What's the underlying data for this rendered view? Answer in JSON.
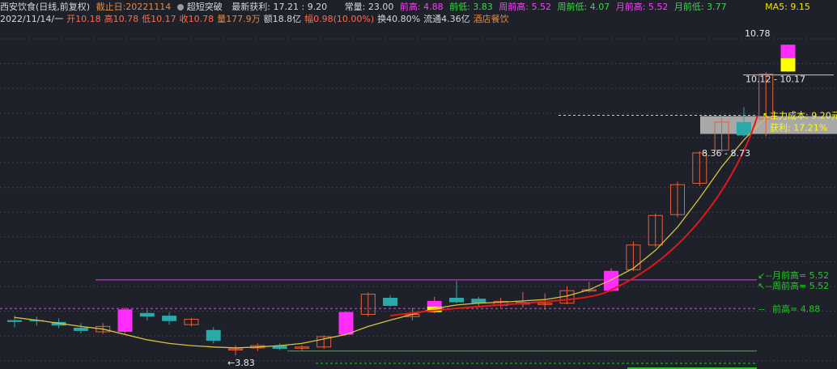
{
  "header": {
    "row1": {
      "stock_name": "西安饮食(日线,前复权)",
      "cutoff": "截止日:20221114",
      "signal": "超短突破",
      "profit": "最新获利: 17.21 : 9.20",
      "normal": "常量: 23.00",
      "prev_high": "前高: 4.88",
      "prev_low": "前低: 3.83",
      "week_high": "周前高: 5.52",
      "week_low": "周前低: 4.07",
      "month_high": "月前高: 5.52",
      "month_low": "月前低: 3.77",
      "ma5": "MA5: 9.15"
    },
    "row2": {
      "date": "2022/11/14/一",
      "open": "开10.18",
      "high": "高10.78",
      "low": "低10.17",
      "close": "收10.78",
      "volume": "量177.9万",
      "amount": "额18.8亿",
      "change": "幅0.98(10.00%)",
      "turnover": "换40.80%",
      "float": "流通4.36亿",
      "industry": "酒店餐饮"
    }
  },
  "annotations": {
    "high_price": "10.78",
    "range_top": "10.12 - 10.17",
    "cost_label": "主力成本:  9.20元",
    "profit_label": "获利:  17.21%",
    "range_mid": "8.36 - 8.73",
    "month_prev_high": "--月前高= 5.52",
    "week_prev_high": "--周前高= 5.52",
    "prev_high_line": "前高= 4.88",
    "low_marker": "←3.83"
  },
  "colors": {
    "background": "#1e2129",
    "up": "#e8603a",
    "down": "#2aa9a9",
    "magenta": "#ff2cff",
    "yellow": "#ffff00",
    "ma5": "#d8c040",
    "cost_line": "#e01818",
    "green_line": "#27c627"
  },
  "chart_data": {
    "type": "candlestick",
    "title": "西安饮食(日线,前复权)",
    "ylim": [
      3.6,
      11.2
    ],
    "grid": true,
    "candles": [
      {
        "o": 4.62,
        "h": 4.72,
        "l": 4.46,
        "c": 4.58
      },
      {
        "o": 4.62,
        "h": 4.7,
        "l": 4.5,
        "c": 4.6
      },
      {
        "o": 4.58,
        "h": 4.66,
        "l": 4.44,
        "c": 4.5
      },
      {
        "o": 4.45,
        "h": 4.55,
        "l": 4.33,
        "c": 4.38
      },
      {
        "o": 4.36,
        "h": 4.55,
        "l": 4.31,
        "c": 4.48
      },
      {
        "o": 4.36,
        "h": 4.9,
        "l": 4.33,
        "c": 4.86,
        "mark": "break"
      },
      {
        "o": 4.78,
        "h": 4.85,
        "l": 4.62,
        "c": 4.7
      },
      {
        "o": 4.72,
        "h": 4.8,
        "l": 4.52,
        "c": 4.6
      },
      {
        "o": 4.52,
        "h": 4.67,
        "l": 4.48,
        "c": 4.64
      },
      {
        "o": 4.4,
        "h": 4.46,
        "l": 4.1,
        "c": 4.16
      },
      {
        "o": 3.98,
        "h": 4.06,
        "l": 3.83,
        "c": 3.98
      },
      {
        "o": 4.0,
        "h": 4.1,
        "l": 3.93,
        "c": 4.05
      },
      {
        "o": 4.05,
        "h": 4.1,
        "l": 3.95,
        "c": 3.98
      },
      {
        "o": 4.0,
        "h": 4.06,
        "l": 3.94,
        "c": 4.02
      },
      {
        "o": 4.02,
        "h": 4.28,
        "l": 3.98,
        "c": 4.25
      },
      {
        "o": 4.3,
        "h": 4.82,
        "l": 4.28,
        "c": 4.8,
        "mark": "prev"
      },
      {
        "o": 4.75,
        "h": 5.24,
        "l": 4.7,
        "c": 5.2
      },
      {
        "o": 5.12,
        "h": 5.18,
        "l": 4.92,
        "c": 4.94
      },
      {
        "o": 4.7,
        "h": 4.9,
        "l": 4.62,
        "c": 4.75
      },
      {
        "o": 4.8,
        "h": 5.14,
        "l": 4.78,
        "c": 5.05,
        "mark": "mid"
      },
      {
        "o": 5.12,
        "h": 5.5,
        "l": 5.0,
        "c": 5.02
      },
      {
        "o": 5.1,
        "h": 5.14,
        "l": 4.92,
        "c": 5.0
      },
      {
        "o": 4.95,
        "h": 5.12,
        "l": 4.9,
        "c": 5.04
      },
      {
        "o": 4.98,
        "h": 5.25,
        "l": 4.9,
        "c": 5.02
      },
      {
        "o": 4.97,
        "h": 5.22,
        "l": 4.85,
        "c": 5.0
      },
      {
        "o": 5.0,
        "h": 5.38,
        "l": 4.98,
        "c": 5.28
      },
      {
        "o": 5.28,
        "h": 5.48,
        "l": 5.24,
        "c": 5.3
      },
      {
        "o": 5.28,
        "h": 5.78,
        "l": 5.25,
        "c": 5.72,
        "mark": "break"
      },
      {
        "o": 5.75,
        "h": 6.38,
        "l": 5.72,
        "c": 6.3
      },
      {
        "o": 6.3,
        "h": 7.0,
        "l": 6.25,
        "c": 6.96
      },
      {
        "o": 6.98,
        "h": 7.72,
        "l": 6.92,
        "c": 7.65
      },
      {
        "o": 7.68,
        "h": 8.4,
        "l": 7.62,
        "c": 8.36
      },
      {
        "o": 8.42,
        "h": 9.15,
        "l": 8.38,
        "c": 9.05
      },
      {
        "o": 9.05,
        "h": 9.38,
        "l": 8.72,
        "c": 8.75
      },
      {
        "o": 9.12,
        "h": 10.17,
        "l": 8.73,
        "c": 10.12
      },
      {
        "o": 10.18,
        "h": 10.78,
        "l": 10.17,
        "c": 10.78,
        "mark": "top"
      }
    ],
    "ma5": [
      4.68,
      4.62,
      4.55,
      4.48,
      4.42,
      4.3,
      4.18,
      4.1,
      4.05,
      4.02,
      4.0,
      4.02,
      4.05,
      4.1,
      4.2,
      4.3,
      4.48,
      4.62,
      4.75,
      4.88,
      4.96,
      5.0,
      5.02,
      5.05,
      5.08,
      5.16,
      5.3,
      5.52,
      5.78,
      6.18,
      6.7,
      7.35,
      8.05,
      8.65,
      9.15
    ]
  }
}
